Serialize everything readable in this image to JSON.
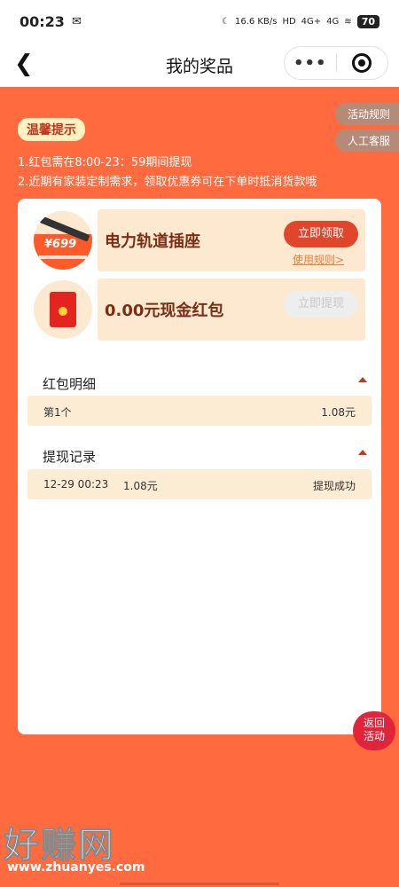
{
  "status_bar": {
    "time": "00:23",
    "speed": "16.6 KB/s",
    "hd": "HD",
    "net1": "4G+",
    "net2": "4G",
    "battery": "70"
  },
  "nav": {
    "title": "我的奖品",
    "more": "•••"
  },
  "side_buttons": {
    "rules": "活动规则",
    "service": "人工客服"
  },
  "tips": {
    "title": "温馨提示",
    "line1": "1.红包需在8:00-23：59期间提现",
    "line2": "2.近期有家装定制需求，领取优惠券可在下单时抵消货款哦"
  },
  "prizes": [
    {
      "name": "电力轨道插座",
      "button": "立即领取",
      "link": "使用规则>",
      "thumb_price": "¥699",
      "icon": "power-rail-image"
    },
    {
      "name": "0.00元现金红包",
      "button": "立即提现",
      "icon": "red-packet-image"
    }
  ],
  "redpack_detail": {
    "title": "红包明细",
    "rows": [
      {
        "label": "第1个",
        "amount": "1.08元"
      }
    ]
  },
  "withdraw_records": {
    "title": "提现记录",
    "rows": [
      {
        "time": "12-29 00:23",
        "amount": "1.08元",
        "status": "提现成功"
      }
    ]
  },
  "return_button": {
    "line1": "返回",
    "line2": "活动"
  },
  "watermark": {
    "text": "好赚网",
    "url": "www.zhuanyes.com"
  },
  "colors": {
    "background": "#ff6a3f",
    "accent": "#e0462c",
    "panel": "#fde9d0"
  }
}
